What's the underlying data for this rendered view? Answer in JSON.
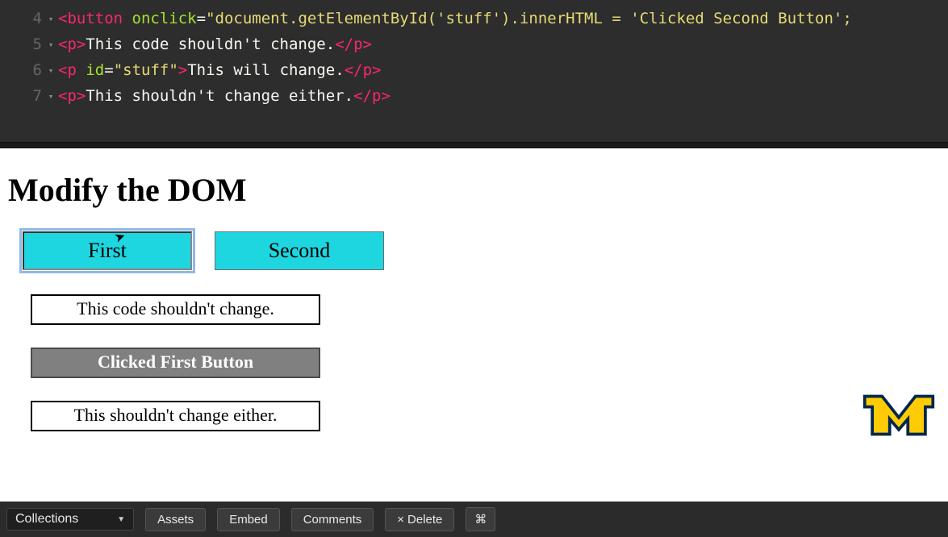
{
  "editor": {
    "lines": [
      {
        "num": "4",
        "segments": [
          {
            "cls": "tag",
            "t": "<button"
          },
          {
            "cls": "plain",
            "t": " "
          },
          {
            "cls": "attr-name",
            "t": "onclick"
          },
          {
            "cls": "op",
            "t": "="
          },
          {
            "cls": "string",
            "t": "\"document.getElementById('stuff').innerHTML = 'Clicked Second Button';"
          }
        ]
      },
      {
        "num": "5",
        "segments": [
          {
            "cls": "tag",
            "t": "<p>"
          },
          {
            "cls": "plain",
            "t": "This code shouldn't change."
          },
          {
            "cls": "tag",
            "t": "</p>"
          }
        ]
      },
      {
        "num": "6",
        "segments": [
          {
            "cls": "tag",
            "t": "<p"
          },
          {
            "cls": "plain",
            "t": " "
          },
          {
            "cls": "attr-name",
            "t": "id"
          },
          {
            "cls": "op",
            "t": "="
          },
          {
            "cls": "string",
            "t": "\"stuff\""
          },
          {
            "cls": "tag",
            "t": ">"
          },
          {
            "cls": "plain",
            "t": "This will change."
          },
          {
            "cls": "tag",
            "t": "</p>"
          }
        ]
      },
      {
        "num": "7",
        "segments": [
          {
            "cls": "tag",
            "t": "<p>"
          },
          {
            "cls": "plain",
            "t": "This shouldn't change either."
          },
          {
            "cls": "tag",
            "t": "</p>"
          }
        ]
      }
    ]
  },
  "output": {
    "heading": "Modify the DOM",
    "buttons": {
      "first": "First",
      "second": "Second"
    },
    "paragraphs": {
      "p1": "This code shouldn't change.",
      "p2": "Clicked First Button",
      "p3": "This shouldn't change either."
    }
  },
  "toolbar": {
    "collections": "Collections",
    "assets": "Assets",
    "embed": "Embed",
    "comments": "Comments",
    "delete": "Delete",
    "shortcut": "⌘"
  }
}
